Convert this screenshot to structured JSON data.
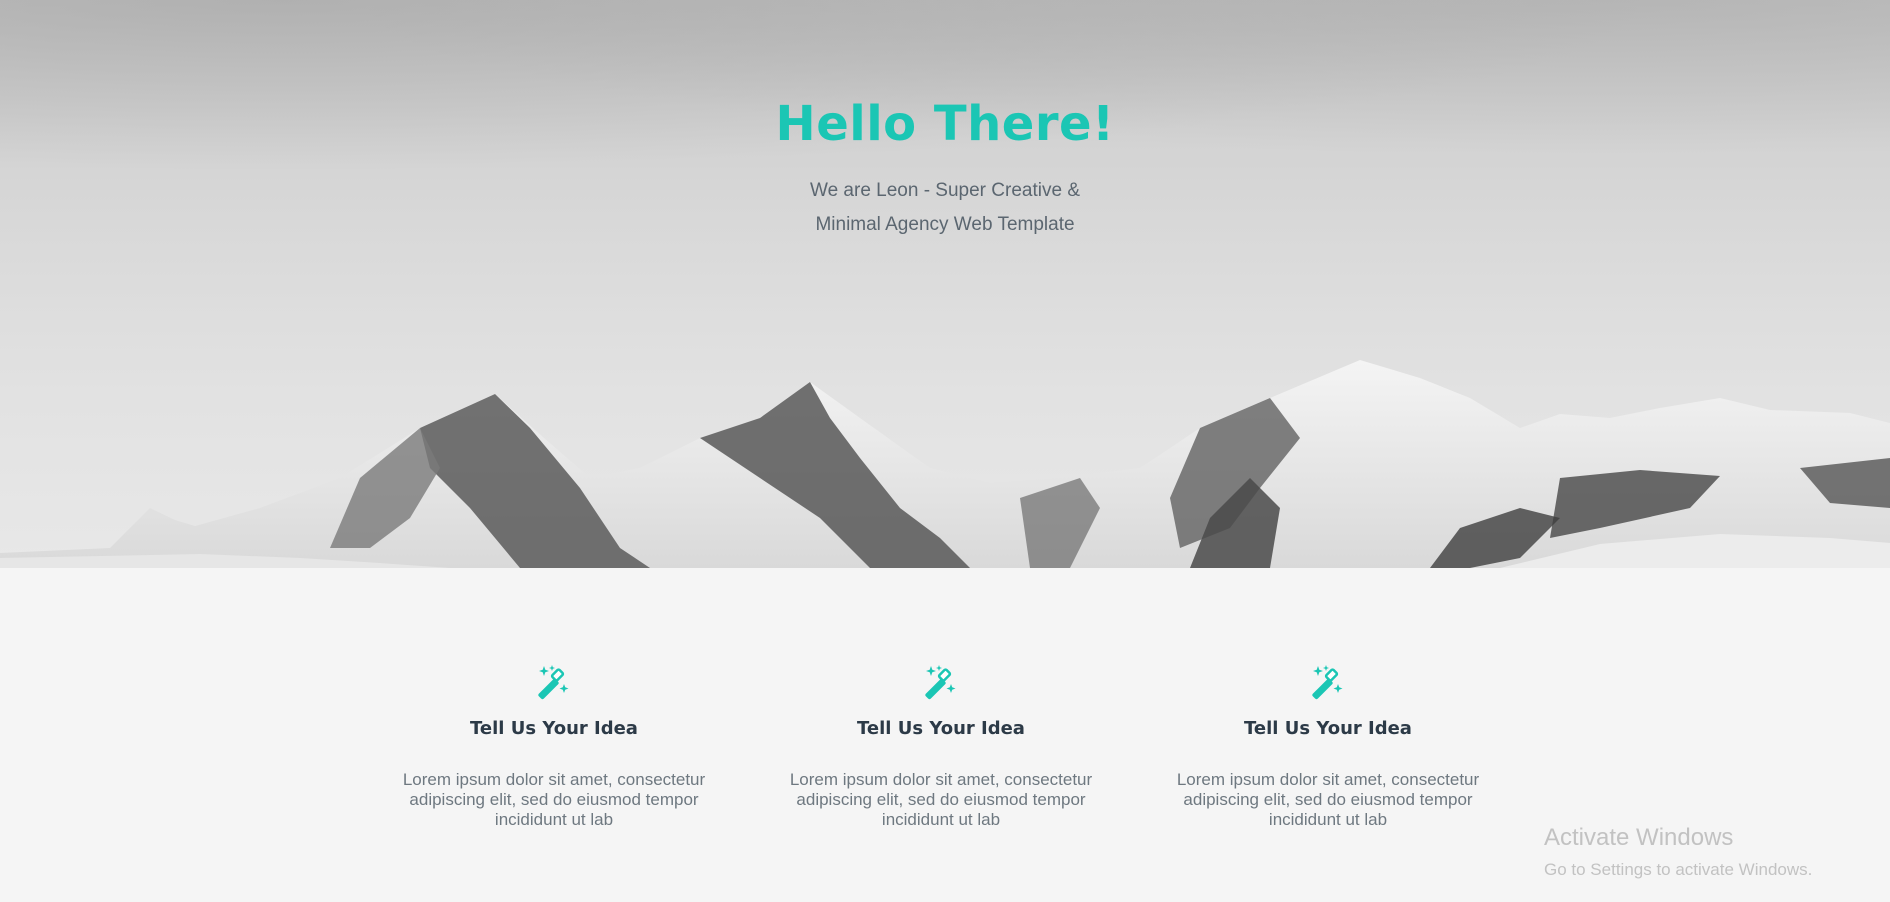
{
  "hero": {
    "title": "Hello There!",
    "subtitle_line1": "We are Leon - Super Creative &",
    "subtitle_line2": "Minimal Agency Web Template"
  },
  "features": [
    {
      "icon": "magic-wand-icon",
      "title": "Tell Us Your Idea",
      "text": "Lorem ipsum dolor sit amet, consectetur adipiscing elit, sed do eiusmod tempor incididunt ut lab"
    },
    {
      "icon": "magic-wand-icon",
      "title": "Tell Us Your Idea",
      "text": "Lorem ipsum dolor sit amet, consectetur adipiscing elit, sed do eiusmod tempor incididunt ut lab"
    },
    {
      "icon": "magic-wand-icon",
      "title": "Tell Us Your Idea",
      "text": "Lorem ipsum dolor sit amet, consectetur adipiscing elit, sed do eiusmod tempor incididunt ut lab"
    }
  ],
  "watermark": {
    "line1": "Activate Windows",
    "line2": "Go to Settings to activate Windows."
  },
  "colors": {
    "accent": "#1bc6b4",
    "heading": "#2c3a47",
    "body_text": "#6e7880",
    "section_bg": "#f5f5f5"
  }
}
